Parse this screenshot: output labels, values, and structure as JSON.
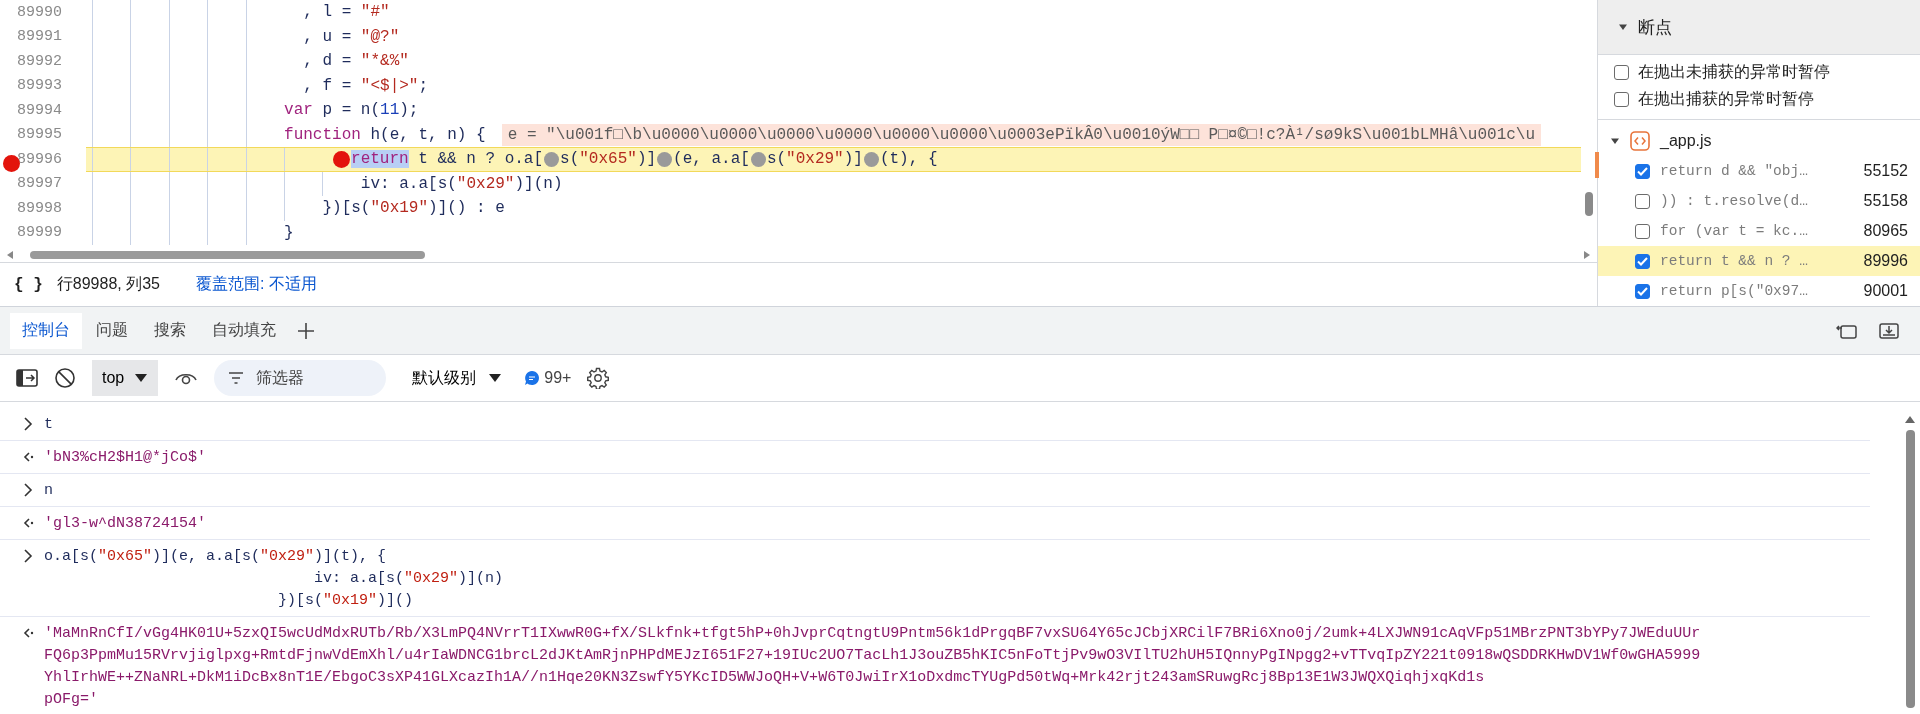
{
  "source": {
    "lines": [
      {
        "number": "89990",
        "breakpoint": false,
        "paused": false,
        "segments": [
          {
            "kind": "plain",
            "text": "                      , l = "
          },
          {
            "kind": "string",
            "text": "\"#\""
          }
        ]
      },
      {
        "number": "89991",
        "breakpoint": false,
        "paused": false,
        "segments": [
          {
            "kind": "plain",
            "text": "                      , u = "
          },
          {
            "kind": "string",
            "text": "\"@?\""
          }
        ]
      },
      {
        "number": "89992",
        "breakpoint": false,
        "paused": false,
        "segments": [
          {
            "kind": "plain",
            "text": "                      , d = "
          },
          {
            "kind": "string",
            "text": "\"*&%\""
          }
        ]
      },
      {
        "number": "89993",
        "breakpoint": false,
        "paused": false,
        "segments": [
          {
            "kind": "plain",
            "text": "                      , f = "
          },
          {
            "kind": "string",
            "text": "\"<$|>\""
          },
          {
            "kind": "plain",
            "text": ";"
          }
        ]
      },
      {
        "number": "89994",
        "breakpoint": false,
        "paused": false,
        "segments": [
          {
            "kind": "keyword",
            "text": "                    var"
          },
          {
            "kind": "plain",
            "text": " p = n("
          },
          {
            "kind": "number",
            "text": "11"
          },
          {
            "kind": "plain",
            "text": ");"
          }
        ]
      },
      {
        "number": "89995",
        "breakpoint": false,
        "paused": false,
        "inline_value": "e = \"\\u001f□\\b\\u0000\\u0000\\u0000\\u0000\\u0000\\u0000\\u0003ePïkÂ0\\u0010ýW□□ P□¤©□!c?À¹/sø9kS\\u001bLMHâ\\u001c\\u",
        "segments": [
          {
            "kind": "keyword",
            "text": "                    function"
          },
          {
            "kind": "plain",
            "text": " h(e, t, n) {"
          }
        ]
      },
      {
        "number": "89996",
        "breakpoint": true,
        "paused": true,
        "segments": [
          {
            "kind": "selection",
            "text": "                          return",
            "breakpoint_before": {
              "active": true
            }
          },
          {
            "kind": "plain",
            "text": " t && n ? o.a["
          },
          {
            "kind": "plain",
            "text": "s(",
            "breakpoint_before": {
              "active": false
            }
          },
          {
            "kind": "string",
            "text": "\"0x65\""
          },
          {
            "kind": "plain",
            "text": ")]"
          },
          {
            "kind": "plain",
            "text": "(e, a.a[",
            "breakpoint_before": {
              "active": false
            }
          },
          {
            "kind": "plain",
            "text": "s(",
            "breakpoint_before": {
              "active": false
            }
          },
          {
            "kind": "string",
            "text": "\"0x29\""
          },
          {
            "kind": "plain",
            "text": ")]"
          },
          {
            "kind": "plain",
            "text": "(t), {",
            "breakpoint_before": {
              "active": false
            }
          }
        ]
      },
      {
        "number": "89997",
        "breakpoint": false,
        "paused": false,
        "segments": [
          {
            "kind": "plain",
            "text": "                            iv: a.a[s("
          },
          {
            "kind": "string",
            "text": "\"0x29\""
          },
          {
            "kind": "plain",
            "text": ")](n)"
          }
        ]
      },
      {
        "number": "89998",
        "breakpoint": false,
        "paused": false,
        "segments": [
          {
            "kind": "plain",
            "text": "                        })[s("
          },
          {
            "kind": "string",
            "text": "\"0x19\""
          },
          {
            "kind": "plain",
            "text": ")]() : e"
          }
        ]
      },
      {
        "number": "89999",
        "breakpoint": false,
        "paused": false,
        "segments": [
          {
            "kind": "plain",
            "text": "                    }"
          }
        ]
      }
    ]
  },
  "status_bar": {
    "braces": "{ }",
    "position": "行89988, 列35",
    "coverage": "覆盖范围: 不适用"
  },
  "breakpoints": {
    "title": "断点",
    "expanded": true,
    "options": [
      {
        "label": "在抛出未捕获的异常时暂停",
        "checked": false
      },
      {
        "label": "在抛出捕获的异常时暂停",
        "checked": false
      }
    ],
    "files": [
      {
        "name": "_app.js",
        "expanded": true,
        "items": [
          {
            "code": "return d && \"obj…",
            "line": "55152",
            "checked": true,
            "active": false
          },
          {
            "code": ")) : t.resolve(d…",
            "line": "55158",
            "checked": false,
            "active": false
          },
          {
            "code": "for (var t = kc.…",
            "line": "80965",
            "checked": false,
            "active": false
          },
          {
            "code": "return t && n ? …",
            "line": "89996",
            "checked": true,
            "active": true
          },
          {
            "code": "return p[s(\"0x97…",
            "line": "90001",
            "checked": true,
            "active": false
          }
        ]
      }
    ]
  },
  "drawer_tabs": [
    {
      "label": "控制台",
      "selected": true
    },
    {
      "label": "问题",
      "selected": false
    },
    {
      "label": "搜索",
      "selected": false
    },
    {
      "label": "自动填充",
      "selected": false
    }
  ],
  "toolbar": {
    "context": "top",
    "filter_placeholder": "筛选器",
    "log_level": "默认级别",
    "message_count": "99+"
  },
  "console": [
    {
      "kind": "input",
      "lines": [
        [
          {
            "kind": "plain",
            "text": "t"
          }
        ]
      ]
    },
    {
      "kind": "output",
      "lines": [
        [
          {
            "kind": "result_string",
            "text": "'bN3%cH2$H1@*jCo$'"
          }
        ]
      ]
    },
    {
      "kind": "input",
      "lines": [
        [
          {
            "kind": "plain",
            "text": "n"
          }
        ]
      ]
    },
    {
      "kind": "output",
      "lines": [
        [
          {
            "kind": "result_string",
            "text": "'gl3-w^dN38724154'"
          }
        ]
      ]
    },
    {
      "kind": "input",
      "lines": [
        [
          {
            "kind": "plain",
            "text": "o.a[s("
          },
          {
            "kind": "console_string",
            "text": "\"0x65\""
          },
          {
            "kind": "plain",
            "text": ")](e, a.a[s("
          },
          {
            "kind": "console_string",
            "text": "\"0x29\""
          },
          {
            "kind": "plain",
            "text": ")](t), {"
          }
        ],
        [
          {
            "kind": "plain",
            "text": "                              iv: a.a[s("
          },
          {
            "kind": "console_string",
            "text": "\"0x29\""
          },
          {
            "kind": "plain",
            "text": ")](n)"
          }
        ],
        [
          {
            "kind": "plain",
            "text": "                          })[s("
          },
          {
            "kind": "console_string",
            "text": "\"0x19\""
          },
          {
            "kind": "plain",
            "text": ")]()"
          }
        ]
      ]
    },
    {
      "kind": "output",
      "lines": [
        [
          {
            "kind": "result_string",
            "text": "'MaMnRnCfI/vGg4HK01U+5zxQI5wcUdMdxRUTb/Rb/X3LmPQ4NVrrT1IXwwR0G+fX/SLkfnk+tfgt5hP+0hJvprCqtngtU9Pntm56k1dPrgqBF7vxSU64Y65cJCbjXRCilF7BRi6Xno0j/2umk+4LXJWN91cAqVFp51MBrzPNT3bYPy7JWEduUUr"
          }
        ],
        [
          {
            "kind": "result_string",
            "text": "FQ6p3PpmMu15RVrvjiglpxg+RmtdFjnwVdEmXhl/u4rIaWDNCG1brcL2dJKtAmRjnPHPdMEJzI651F27+19IUc2UO7TacLh1J3ouZB5hKIC5nFoTtjPv9wO3VIlTU2hUH5IQnnyPgINpgg2+vTTvqIpZY221t0918wQSDDRKHwDV1Wf0wGHA5999"
          }
        ],
        [
          {
            "kind": "result_string",
            "text": "YhlIrhWE++ZNaNRL+DkM1iDcBx8nT1E/EbgoC3sXP41GLXcazIh1A//n1Hqe20KN3ZswfY5YKcID5WWJoQH+V+W6T0JwiIrX1oDxdmcTYUgPd50tWq+Mrk42rjt243amSRuwgRcj8Bp13E1W3JWQXQiqhjxqKd1s"
          }
        ],
        [
          {
            "kind": "result_string",
            "text": "pOFg='"
          }
        ]
      ]
    }
  ]
}
